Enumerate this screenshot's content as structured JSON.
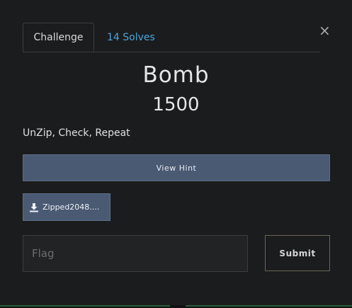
{
  "tabs": {
    "challenge": "Challenge",
    "solves": "14 Solves"
  },
  "close_symbol": "×",
  "challenge": {
    "name": "Bomb",
    "points": "1500",
    "description": "UnZip, Check, Repeat"
  },
  "hint_button": {
    "label": "View Hint"
  },
  "file": {
    "label": "Zipped2048....",
    "icon": "download-icon"
  },
  "flag_input": {
    "placeholder": "Flag",
    "value": ""
  },
  "submit_button": {
    "label": "Submit"
  },
  "colors": {
    "background": "#1b1c1e",
    "accent_link": "#4ea3d9",
    "button": "#4a5a73"
  }
}
